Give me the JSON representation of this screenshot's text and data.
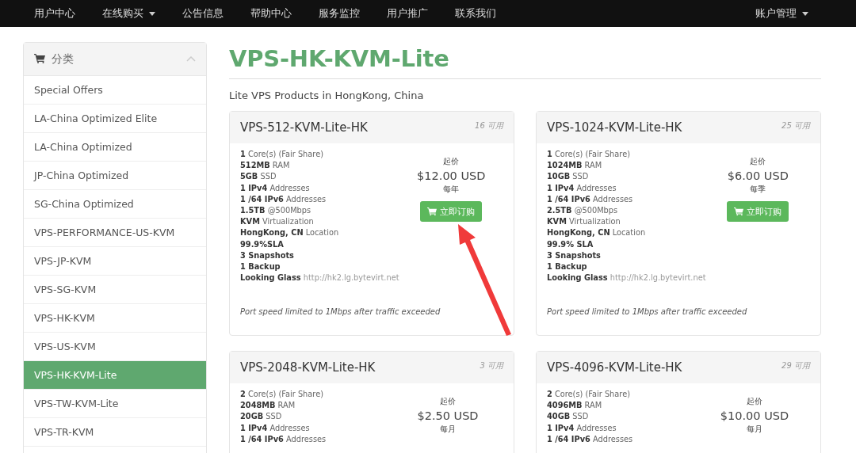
{
  "nav": {
    "items": [
      {
        "label": "用户中心",
        "dropdown": false
      },
      {
        "label": "在线购买",
        "dropdown": true
      },
      {
        "label": "公告信息",
        "dropdown": false
      },
      {
        "label": "帮助中心",
        "dropdown": false
      },
      {
        "label": "服务监控",
        "dropdown": false
      },
      {
        "label": "用户推广",
        "dropdown": false
      },
      {
        "label": "联系我们",
        "dropdown": false
      }
    ],
    "account": {
      "label": "账户管理",
      "dropdown": true
    }
  },
  "sidebar": {
    "title": "分类",
    "expanded": true,
    "items": [
      {
        "label": "Special Offers",
        "selected": false
      },
      {
        "label": "LA-China Optimized Elite",
        "selected": false
      },
      {
        "label": "LA-China Optimized",
        "selected": false
      },
      {
        "label": "JP-China Optimized",
        "selected": false
      },
      {
        "label": "SG-China Optimized",
        "selected": false
      },
      {
        "label": "VPS-PERFORMANCE-US-KVM",
        "selected": false
      },
      {
        "label": "VPS-JP-KVM",
        "selected": false
      },
      {
        "label": "VPS-SG-KVM",
        "selected": false
      },
      {
        "label": "VPS-HK-KVM",
        "selected": false
      },
      {
        "label": "VPS-US-KVM",
        "selected": false
      },
      {
        "label": "VPS-HK-KVM-Lite",
        "selected": true
      },
      {
        "label": "VPS-TW-KVM-Lite",
        "selected": false
      },
      {
        "label": "VPS-TR-KVM",
        "selected": false
      }
    ]
  },
  "page": {
    "title": "VPS-HK-KVM-Lite",
    "subtitle": "Lite VPS Products in HongKong, China"
  },
  "products": [
    {
      "name": "VPS-512-KVM-Lite-HK",
      "available": "16 可用",
      "features": [
        {
          "strong": "1",
          "text": "Core(s) (Fair Share)"
        },
        {
          "strong": "512MB",
          "text": "RAM"
        },
        {
          "strong": "5GB",
          "text": "SSD"
        },
        {
          "strong": "1 IPv4",
          "text": "Addresses"
        },
        {
          "strong": "1 /64 IPv6",
          "text": "Addresses"
        },
        {
          "strong": "1.5TB",
          "text": "@500Mbps"
        },
        {
          "strong": "KVM",
          "text": "Virtualization"
        },
        {
          "strong": "HongKong, CN",
          "text": "Location"
        },
        {
          "strong": "99.9%SLA"
        },
        {
          "strong": "3 Snapshots"
        },
        {
          "strong": "1 Backup"
        },
        {
          "strong": "Looking Glass",
          "link": "http://hk2.lg.bytevirt.net"
        }
      ],
      "note": "Port speed limited to 1Mbps after traffic exceeded",
      "price_label": "起价",
      "price": "$12.00 USD",
      "cycle": "每年",
      "order": "立即订购"
    },
    {
      "name": "VPS-1024-KVM-Lite-HK",
      "available": "25 可用",
      "features": [
        {
          "strong": "1",
          "text": "Core(s) (Fair Share)"
        },
        {
          "strong": "1024MB",
          "text": "RAM"
        },
        {
          "strong": "10GB",
          "text": "SSD"
        },
        {
          "strong": "1 IPv4",
          "text": "Addresses"
        },
        {
          "strong": "1 /64 IPv6",
          "text": "Addresses"
        },
        {
          "strong": "2.5TB",
          "text": "@500Mbps"
        },
        {
          "strong": "KVM",
          "text": "Virtualization"
        },
        {
          "strong": "HongKong, CN",
          "text": "Location"
        },
        {
          "strong": "99.9% SLA"
        },
        {
          "strong": "3 Snapshots"
        },
        {
          "strong": "1 Backup"
        },
        {
          "strong": "Looking Glass",
          "link": "http://hk2.lg.bytevirt.net"
        }
      ],
      "note": "Port speed limited to 1Mbps after traffic exceeded",
      "price_label": "起价",
      "price": "$6.00 USD",
      "cycle": "每季",
      "order": "立即订购"
    },
    {
      "name": "VPS-2048-KVM-Lite-HK",
      "available": "3 可用",
      "features": [
        {
          "strong": "2",
          "text": "Core(s) (Fair Share)"
        },
        {
          "strong": "2048MB",
          "text": "RAM"
        },
        {
          "strong": "20GB",
          "text": "SSD"
        },
        {
          "strong": "1 IPv4",
          "text": "Addresses"
        },
        {
          "strong": "1 /64 IPv6",
          "text": "Addresses"
        }
      ],
      "price_label": "起价",
      "price": "$2.50 USD",
      "cycle": "每月"
    },
    {
      "name": "VPS-4096-KVM-Lite-HK",
      "available": "29 可用",
      "features": [
        {
          "strong": "2",
          "text": "Core(s) (Fair Share)"
        },
        {
          "strong": "4096MB",
          "text": "RAM"
        },
        {
          "strong": "40GB",
          "text": "SSD"
        },
        {
          "strong": "1 IPv4",
          "text": "Addresses"
        },
        {
          "strong": "1 /64 IPv6",
          "text": "Addresses"
        }
      ],
      "price_label": "起价",
      "price": "$10.00 USD",
      "cycle": "每月"
    }
  ]
}
